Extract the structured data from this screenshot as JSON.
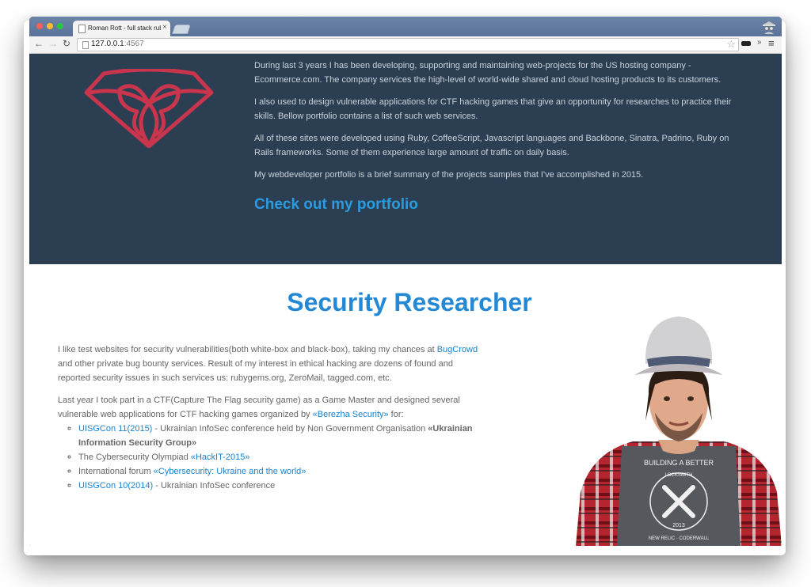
{
  "browser": {
    "tab_title": "Roman Rott - full stack ruby",
    "tab_close": "×",
    "url_host": "127.0.0.1",
    "url_port": ":4567",
    "nav_back": "←",
    "nav_forward": "→",
    "nav_reload": "↻",
    "star": "☆",
    "more": "»",
    "menu": "≡"
  },
  "hero": {
    "paragraphs": [
      "During last 3 years I has been developing, supporting and maintaining web-projects for the US hosting company - Ecommerce.com. The company services the high-level of world-wide shared and cloud hosting products to its customers.",
      "I also used to design vulnerable applications for CTF hacking games that give an opportunity for researches to practice their skills. Bellow portfolio contains a list of such web services.",
      "All of these sites were developed using Ruby, CoffeeScript, Javascript languages and Backbone, Sinatra, Padrino, Ruby on Rails frameworks. Some of them experience large amount of traffic on daily basis.",
      "My webdeveloper portfolio is a brief summary of the projects samples that I've accomplished in 2015."
    ],
    "portfolio_link": "Check out my portfolio"
  },
  "security": {
    "title": "Security Researcher",
    "p1_before": "I like test websites for security vulnerabilities(both white-box and black-box), taking my chances at ",
    "p1_link": "BugCrowd",
    "p1_after": " and other private bug bounty services. Result of my interest in ethical hacking are dozens of found and reported security issues in such services us: rubygems.org, ZeroMail, tagged.com, etc.",
    "p2_before": "Last year I took part in a CTF(Capture The Flag security game) as a Game Master and designed several vulnerable web applications for CTF hacking games organized by ",
    "p2_link": "«Berezha Security»",
    "p2_after": " for:",
    "items": [
      {
        "link": "UISGCon 11(2015)",
        "text": " - Ukrainian InfoSec conference held by Non Government Organisation ",
        "bold": "«Ukrainian Information Security Group»"
      },
      {
        "text": "The Cybersecurity Olympiad ",
        "link": "«HackIT-2015»"
      },
      {
        "text": "International forum ",
        "link": "«Cybersecurity: Ukraine and the world»"
      },
      {
        "link": "UISGCon 10(2014)",
        "text": " - Ukrainian InfoSec conference"
      }
    ]
  },
  "photo": {
    "shirt_text_top": "BUILDING A BETTER",
    "shirt_text_mid": "LOCKSMITH",
    "shirt_year": "2013",
    "shirt_text_bottom": "NEW RELIC · CODERWALL"
  },
  "colors": {
    "hero_bg": "#2c3e51",
    "accent": "#2389d6",
    "logo": "#c8354d",
    "link": "#1b82cc"
  }
}
